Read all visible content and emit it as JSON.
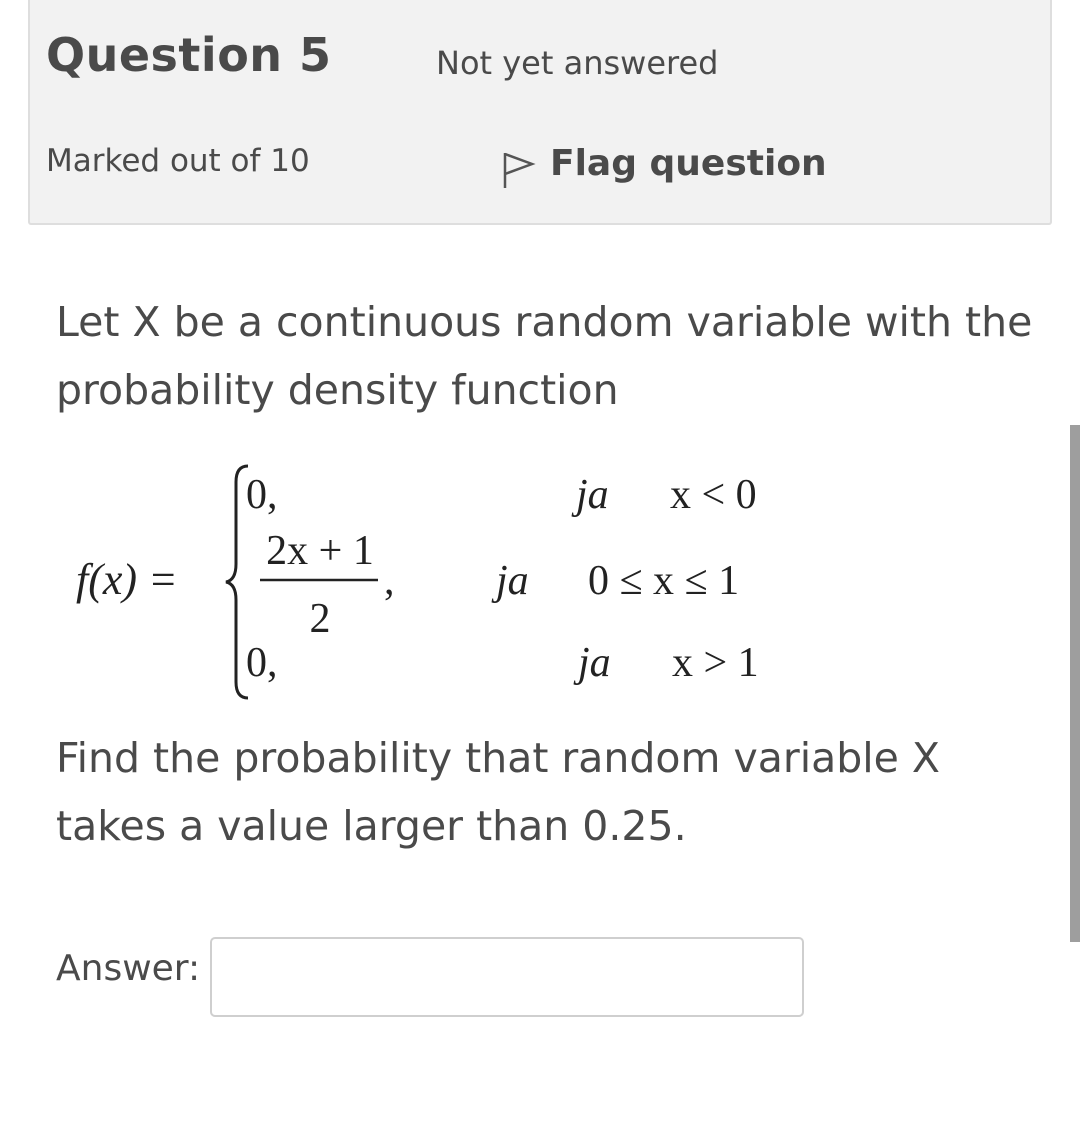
{
  "question_info": {
    "title": "Question 5",
    "state": "Not yet answered",
    "grade": "Marked out of 10",
    "flag_label": "Flag question",
    "flag_icon": "flag-outline-icon"
  },
  "question": {
    "intro": "Let X be a continuous random variable with the probability density function",
    "task": "Find the probability that random variable X takes a value larger than 0.25."
  },
  "formula": {
    "lhs": "f(x) =",
    "case1_value": "0,",
    "case1_cond_word": "ja",
    "case1_cond": "x < 0",
    "case2_numerator": "2x + 1",
    "case2_denominator": "2",
    "case2_comma": ",",
    "case2_cond_word": "ja",
    "case2_cond": "0 ≤ x ≤ 1",
    "case3_value": "0,",
    "case3_cond_word": "ja",
    "case3_cond": "x > 1"
  },
  "answer": {
    "label": "Answer:",
    "value": "",
    "placeholder": ""
  }
}
